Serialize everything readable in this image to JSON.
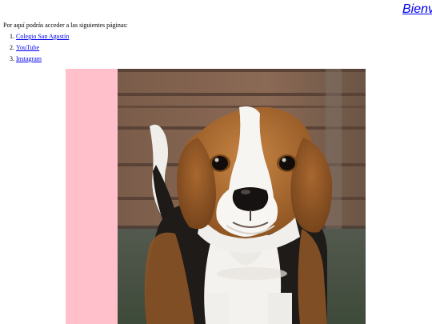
{
  "header": {
    "title_visible": "Bienv"
  },
  "intro": {
    "text": "Por aquí podrás acceder a las siguientes páginas:"
  },
  "links": [
    {
      "number": "1.",
      "label": "Colegio San Agustín"
    },
    {
      "number": "2.",
      "label": "YouTube"
    },
    {
      "number": "3.",
      "label": "Instagram"
    }
  ],
  "image": {
    "subject": "beagle puppy photo",
    "background_color": "#ffc0cb"
  },
  "colors": {
    "link": "#0000ee",
    "text": "#000000"
  }
}
